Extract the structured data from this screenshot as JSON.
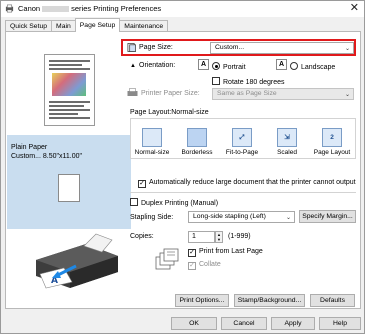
{
  "window": {
    "title_prefix": "Canon",
    "title_suffix": "series Printing Preferences",
    "close_glyph": "✕"
  },
  "tabs": [
    {
      "label": "Quick Setup",
      "active": false
    },
    {
      "label": "Main",
      "active": false
    },
    {
      "label": "Page Setup",
      "active": true
    },
    {
      "label": "Maintenance",
      "active": false
    }
  ],
  "preview": {
    "paper_type": "Plain Paper",
    "paper_size": "Custom... 8.50\"x11.00\""
  },
  "page_size": {
    "label": "Page Size:",
    "value": "Custom...",
    "highlight_color": "#e0191b"
  },
  "orientation": {
    "label": "Orientation:",
    "portrait": "Portrait",
    "landscape": "Landscape",
    "selected": "Portrait",
    "portrait_glyph": "A",
    "landscape_glyph": "A"
  },
  "rotate": {
    "label": "Rotate 180 degrees",
    "checked": false
  },
  "printer_paper_size": {
    "label": "Printer Paper Size:",
    "value": "Same as Page Size",
    "disabled": true
  },
  "page_layout": {
    "label": "Page Layout:Normal-size",
    "items": [
      {
        "label": "Normal-size",
        "glyph": ""
      },
      {
        "label": "Borderless",
        "glyph": ""
      },
      {
        "label": "Fit-to-Page",
        "glyph": "⤢"
      },
      {
        "label": "Scaled",
        "glyph": "⇲"
      },
      {
        "label": "Page Layout",
        "glyph": "2"
      }
    ]
  },
  "auto_reduce": {
    "label": "Automatically reduce large document that the printer cannot output",
    "checked": true
  },
  "duplex": {
    "label": "Duplex Printing (Manual)",
    "checked": false
  },
  "stapling": {
    "label": "Stapling Side:",
    "value": "Long-side stapling (Left)",
    "button": "Specify Margin..."
  },
  "copies": {
    "label": "Copies:",
    "value": "1",
    "range": "(1-999)",
    "print_from_last": {
      "label": "Print from Last Page",
      "checked": true
    },
    "collate": {
      "label": "Collate",
      "checked": true,
      "disabled": true
    }
  },
  "bottom_buttons": {
    "print_options": "Print Options...",
    "stamp": "Stamp/Background...",
    "defaults": "Defaults"
  },
  "dialog_buttons": {
    "ok": "OK",
    "cancel": "Cancel",
    "apply": "Apply",
    "help": "Help"
  },
  "checkmark": "✓",
  "dropdown_arrow": "⌄"
}
